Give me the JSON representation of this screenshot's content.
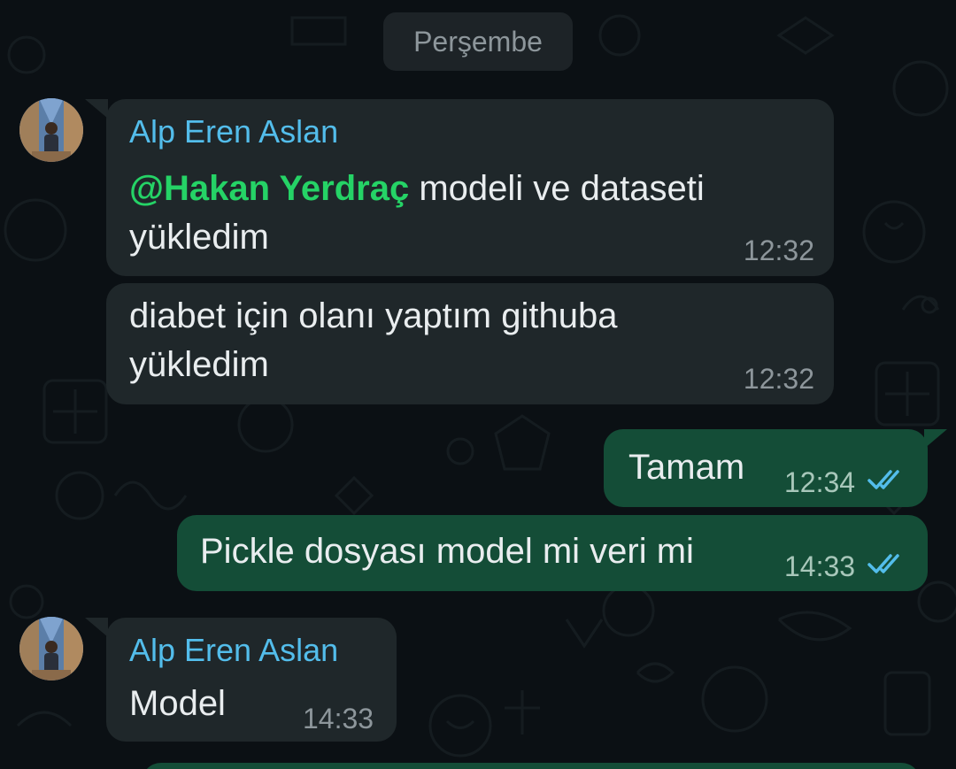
{
  "date_separator": "Perşembe",
  "messages": [
    {
      "direction": "in",
      "sender": "Alp Eren Aslan",
      "mention": "@Hakan Yerdraç",
      "text_line1": " modeli ve dataseti",
      "text_line2": "yükledim",
      "time": "12:32"
    },
    {
      "direction": "in",
      "text_line1": "diabet için olanı yaptım githuba",
      "text_line2": "yükledim",
      "time": "12:32"
    },
    {
      "direction": "out",
      "text": "Tamam",
      "time": "12:34",
      "status_icon": "double-check-read-icon"
    },
    {
      "direction": "out",
      "text": "Pickle dosyası model mi veri mi",
      "time": "14:33",
      "status_icon": "double-check-read-icon"
    },
    {
      "direction": "in",
      "sender": "Alp Eren Aslan",
      "text": "Model",
      "time": "14:33"
    }
  ],
  "colors": {
    "background": "#0b1014",
    "incoming_bubble": "#1f272a",
    "outgoing_bubble": "#144d37",
    "sender_name": "#53bdeb",
    "mention": "#25d366",
    "read_ticks": "#53bdeb"
  }
}
